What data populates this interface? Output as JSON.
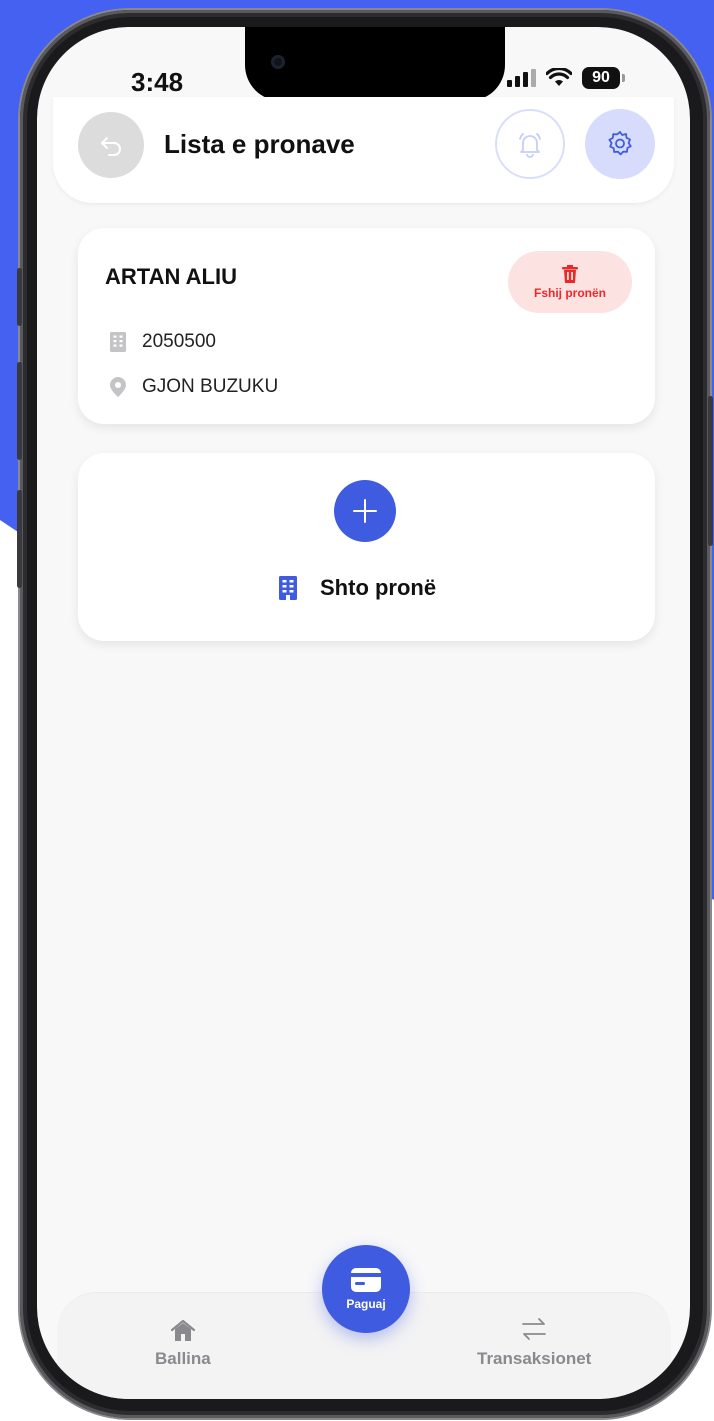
{
  "colors": {
    "background_accent": "#4561f2",
    "primary": "#3f5be0",
    "danger": "#ea2a2a",
    "danger_bg": "#fde2e2"
  },
  "status_bar": {
    "time": "3:48",
    "battery": "90"
  },
  "header": {
    "title": "Lista e pronave",
    "back_icon": "back-arrow-icon",
    "notification_icon": "bell-icon",
    "settings_icon": "gear-icon"
  },
  "property": {
    "owner_name": "ARTAN ALIU",
    "delete_label": "Fshij pronën",
    "delete_icon": "trash-icon",
    "id_icon": "building-icon",
    "property_id": "2050500",
    "address_icon": "location-pin-icon",
    "address": "GJON BUZUKU"
  },
  "add_property": {
    "label": "Shto pronë",
    "plus_icon": "plus-icon",
    "building_icon": "building-icon"
  },
  "bottom_nav": {
    "home_label": "Ballina",
    "home_icon": "home-icon",
    "pay_label": "Paguaj",
    "pay_icon": "card-icon",
    "transactions_label": "Transaksionet",
    "transactions_icon": "transfer-arrows-icon"
  }
}
